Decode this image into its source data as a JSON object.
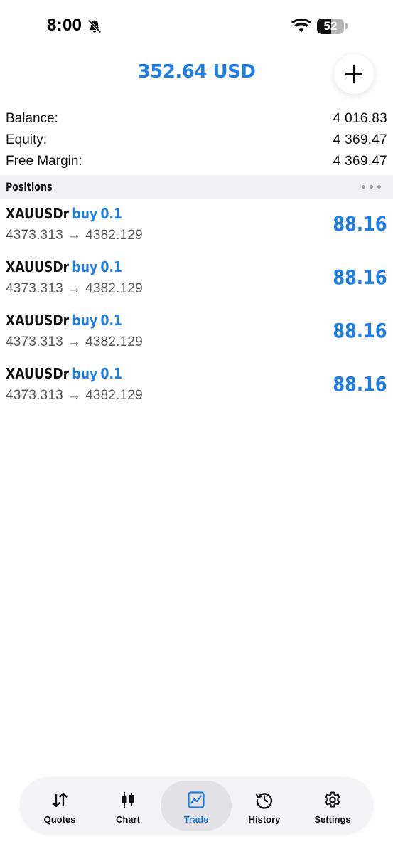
{
  "status_bar": {
    "time": "8:00",
    "battery_level": "52"
  },
  "header": {
    "title": "352.64 USD"
  },
  "summary": {
    "rows": [
      {
        "label": "Balance:",
        "value": "4 016.83"
      },
      {
        "label": "Equity:",
        "value": "4 369.47"
      },
      {
        "label": "Free Margin:",
        "value": "4 369.47"
      }
    ]
  },
  "positions": {
    "title": "Positions",
    "items": [
      {
        "symbol": "XAUUSDr",
        "side": "buy",
        "volume": "0.1",
        "open_price": "4373.313",
        "arrow": "→",
        "current_price": "4382.129",
        "profit": "88.16"
      },
      {
        "symbol": "XAUUSDr",
        "side": "buy",
        "volume": "0.1",
        "open_price": "4373.313",
        "arrow": "→",
        "current_price": "4382.129",
        "profit": "88.16"
      },
      {
        "symbol": "XAUUSDr",
        "side": "buy",
        "volume": "0.1",
        "open_price": "4373.313",
        "arrow": "→",
        "current_price": "4382.129",
        "profit": "88.16"
      },
      {
        "symbol": "XAUUSDr",
        "side": "buy",
        "volume": "0.1",
        "open_price": "4373.313",
        "arrow": "→",
        "current_price": "4382.129",
        "profit": "88.16"
      }
    ]
  },
  "tabs": [
    {
      "label": "Quotes",
      "icon": "quotes-arrows-icon"
    },
    {
      "label": "Chart",
      "icon": "candlestick-icon"
    },
    {
      "label": "Trade",
      "icon": "trade-chart-icon",
      "active": true
    },
    {
      "label": "History",
      "icon": "history-clock-icon"
    },
    {
      "label": "Settings",
      "icon": "gear-icon"
    }
  ],
  "colors": {
    "accent": "#1f7ee0",
    "text": "#111111",
    "secondary_text": "#555555",
    "section_bg": "#f2f2f4"
  }
}
